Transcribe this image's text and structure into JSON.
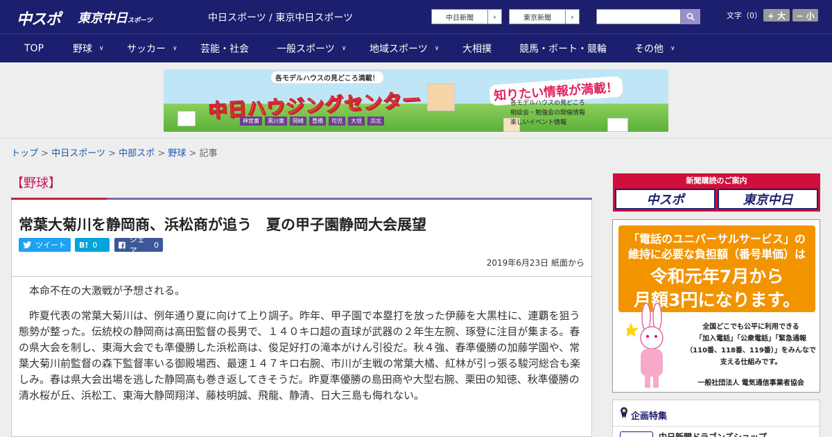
{
  "header": {
    "logo_primary": "中スポ",
    "logo_secondary": "東京中日",
    "logo_secondary_sub": "スポーツ",
    "site_name": "中日スポーツ / 東京中日スポーツ",
    "ext_links": [
      {
        "label": "中日新聞"
      },
      {
        "label": "東京新聞"
      }
    ],
    "search_placeholder": "",
    "font_size_label": "文字（0）",
    "font_plus": "+ 大",
    "font_minus": "− 小"
  },
  "nav": {
    "items": [
      {
        "label": "TOP"
      },
      {
        "label": "野球"
      },
      {
        "label": "サッカー"
      },
      {
        "label": "芸能・社会"
      },
      {
        "label": "一般スポーツ"
      },
      {
        "label": "地域スポーツ"
      },
      {
        "label": "大相撲"
      },
      {
        "label": "競馬・ボート・競輪"
      },
      {
        "label": "その他"
      }
    ]
  },
  "banner": {
    "top_text": "各モデルハウスの見どころ満載！",
    "title": "中日ハウジングセンター",
    "right_title": "知りたい情報が満載！",
    "bullets": [
      "各モデルハウスの見どころ",
      "相談会・勉強会の開催情報",
      "楽しいイベント情報"
    ],
    "cities": [
      "神宮東",
      "黒川東",
      "岡崎",
      "豊橋",
      "可児",
      "大垣",
      "浜北"
    ]
  },
  "breadcrumb": {
    "items": [
      "トップ",
      "中日スポーツ",
      "中部スポ",
      "野球"
    ],
    "current": "記事",
    "separator": ">"
  },
  "article": {
    "category": "【野球】",
    "headline": "常葉大菊川を静岡商、浜松商が追う　夏の甲子園静岡大会展望",
    "share": {
      "tweet_label": "ツイート",
      "hatena_label": "B!",
      "hatena_count": "0",
      "fb_label": "シェア",
      "fb_count": "0"
    },
    "date": "2019年6月23日 紙面から",
    "paragraphs": [
      "本命不在の大激戦が予想される。",
      "昨夏代表の常葉大菊川は、例年通り夏に向けて上り調子。昨年、甲子園で本塁打を放った伊藤を大黒柱に、連覇を狙う態勢が整った。伝統校の静岡商は高田監督の長男で、１４０キロ超の直球が武器の２年生左腕、琢登に注目が集まる。春の県大会を制し、東海大会でも準優勝した浜松商は、俊足好打の滝本がけん引役だ。秋４強、春準優勝の加藤学園や、常葉大菊川前監督の森下監督率いる御殿場西、最速１４７キロ右腕、市川が主戦の常葉大橘、紅林が引っ張る駿河総合も楽しみ。春は県大会出場を逃した静岡高も巻き返してきそうだ。昨夏準優勝の島田商や大型右腕、栗田の知徳、秋準優勝の清水桜が丘、浜松工、東海大静岡翔洋、藤枝明誠、飛龍、静清、日大三島も侮れない。"
    ]
  },
  "sidebar": {
    "subscribe_title": "新聞購読のご案内",
    "subscribe_logo_1": "中スポ",
    "subscribe_logo_2": "東京中日",
    "ad": {
      "line1": "「電話のユニバーサルサービス」の",
      "line2": "維持に必要な負担額（番号単価）は",
      "line3": "令和元年7月から",
      "line4": "月額3円になります。",
      "small": [
        "全国どこでも公平に利用できる",
        "「加入電話」「公衆電話」「緊急通報",
        "（110番、118番、119番）」をみんなで",
        "支える仕組みです。"
      ],
      "org": "一般社団法人 電気通信事業者協会"
    },
    "feature_title": "企画特集",
    "feature_item": "中日新聞ドラゴンズショップ"
  },
  "colors": {
    "header_bg": "#1c1e6e",
    "category_red": "#c41f3a",
    "accent_purple": "#7a6ab0",
    "twitter": "#1da1f2",
    "hatena": "#00a4de",
    "facebook": "#3b5998"
  }
}
